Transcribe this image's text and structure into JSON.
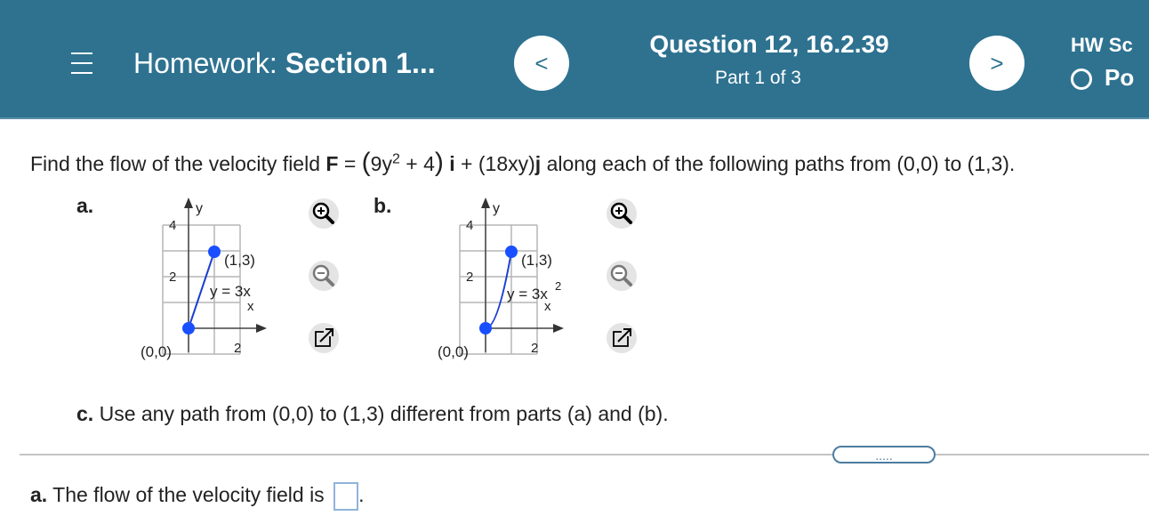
{
  "header": {
    "menu_icon": "hamburger-icon",
    "hw_prefix": "Homework:",
    "hw_section": "Section 1...",
    "prev_label": "<",
    "question_title": "Question 12, 16.2.39",
    "question_part": "Part 1 of 3",
    "next_label": ">",
    "hw_score": "HW Sc",
    "points_text": "Po"
  },
  "problem": {
    "intro": "Find the flow of the velocity field",
    "field_F": "F",
    "equals": " = ",
    "paren_open": "(",
    "term1": "9y",
    "exp": "2",
    "term1b": " + 4",
    "paren_close": ")",
    "i_vec": "i",
    "plus": " + (18xy)",
    "j_vec": "j",
    "rest": " along each of the following paths from (0,0) to (1,3)."
  },
  "graphs": {
    "a": {
      "label": "a.",
      "axis_y": "y",
      "axis_x": "x",
      "tick_y4": "4",
      "tick_y2": "2",
      "tick_x2": "2",
      "point_label": "(1,3)",
      "origin_label": "(0,0)",
      "curve_label": "y = 3x",
      "curve_exp": ""
    },
    "b": {
      "label": "b.",
      "axis_y": "y",
      "axis_x": "x",
      "tick_y4": "4",
      "tick_y2": "2",
      "tick_x2": "2",
      "point_label": "(1,3)",
      "origin_label": "(0,0)",
      "curve_label": "y = 3x",
      "curve_exp": "2"
    }
  },
  "part_c": {
    "label": "c.",
    "text": " Use any path from (0,0) to (1,3) different from parts (a) and (b)."
  },
  "divider": {
    "dots": "....."
  },
  "answer": {
    "label": "a.",
    "text": " The flow of the velocity field is ",
    "period": "."
  },
  "colors": {
    "header_bg": "#2e7290",
    "point_blue": "#1a4fff",
    "curve_blue": "#1a3fd0",
    "input_border": "#8fb3dc"
  },
  "icons": [
    "zoom-in-icon",
    "zoom-out-icon",
    "pop-out-icon"
  ]
}
